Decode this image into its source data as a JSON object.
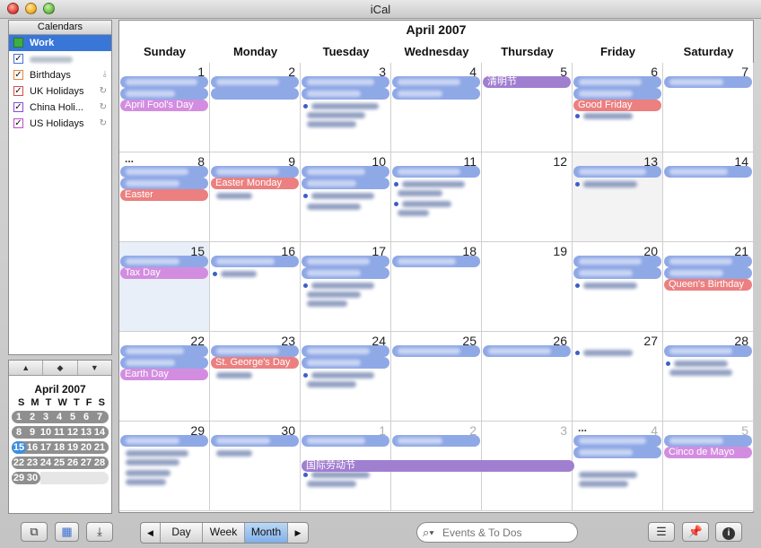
{
  "window": {
    "title": "iCal"
  },
  "sidebar": {
    "header": "Calendars",
    "calendars": [
      {
        "label": "Work",
        "checked": true,
        "color": "#3fae3f",
        "selected": true
      },
      {
        "label": "",
        "checked": true,
        "color": "#4a6fd8",
        "blurred": true
      },
      {
        "label": "Birthdays",
        "checked": true,
        "color": "#e8863a",
        "sub_icon": "subscription-icon"
      },
      {
        "label": "UK Holidays",
        "checked": true,
        "color": "#d84a4a",
        "sub_icon": "refresh-icon"
      },
      {
        "label": "China Holi...",
        "checked": true,
        "color": "#8a4ad8",
        "sub_icon": "refresh-icon"
      },
      {
        "label": "US Holidays",
        "checked": true,
        "color": "#c04ad0",
        "sub_icon": "refresh-icon"
      }
    ]
  },
  "mini_month": {
    "nav": [
      "▲",
      "◆",
      "▼"
    ],
    "title": "April 2007",
    "dow": [
      "S",
      "M",
      "T",
      "W",
      "T",
      "F",
      "S"
    ],
    "weeks": [
      [
        "1",
        "2",
        "3",
        "4",
        "5",
        "6",
        "7"
      ],
      [
        "8",
        "9",
        "10",
        "11",
        "12",
        "13",
        "14"
      ],
      [
        "15",
        "16",
        "17",
        "18",
        "19",
        "20",
        "21"
      ],
      [
        "22",
        "23",
        "24",
        "25",
        "26",
        "27",
        "28"
      ],
      [
        "29",
        "30"
      ]
    ],
    "today": "15"
  },
  "main": {
    "month_title": "April 2007",
    "dow": [
      "Sunday",
      "Monday",
      "Tuesday",
      "Wednesday",
      "Thursday",
      "Friday",
      "Saturday"
    ],
    "weeks": [
      [
        "1",
        "2",
        "3",
        "4",
        "5",
        "6",
        "7"
      ],
      [
        "8",
        "9",
        "10",
        "11",
        "12",
        "13",
        "14"
      ],
      [
        "15",
        "16",
        "17",
        "18",
        "19",
        "20",
        "21"
      ],
      [
        "22",
        "23",
        "24",
        "25",
        "26",
        "27",
        "28"
      ],
      [
        "29",
        "30",
        "1",
        "2",
        "3",
        "4",
        "5"
      ]
    ],
    "more_marker": "...",
    "named_events": {
      "april_fools": "April Fool's Day",
      "qingming": "清明节",
      "good_friday": "Good Friday",
      "easter": "Easter",
      "easter_monday": "Easter Monday",
      "tax_day": "Tax Day",
      "queens_birthday": "Queen's Birthday",
      "st_georges": "St. George's Day",
      "earth_day": "Earth Day",
      "labour_day_cn": "国际劳动节",
      "cinco_de_mayo": "Cinco de Mayo"
    },
    "colors": {
      "work": "#8fa8e6",
      "uk": "#ec7f7f",
      "china": "#a07ed0",
      "us": "#d38de0"
    }
  },
  "toolbar": {
    "view_buttons": [
      "Day",
      "Week",
      "Month"
    ],
    "active_view": "Month",
    "prev_icon": "◀",
    "next_icon": "▶",
    "search_placeholder": "Events & To Dos",
    "search_icon": "magnifier-icon",
    "left_icons": [
      "add-calendar-icon",
      "mini-month-toggle-icon",
      "publish-icon"
    ],
    "right_icons": [
      "todo-list-icon",
      "pin-icon",
      "info-icon"
    ]
  }
}
